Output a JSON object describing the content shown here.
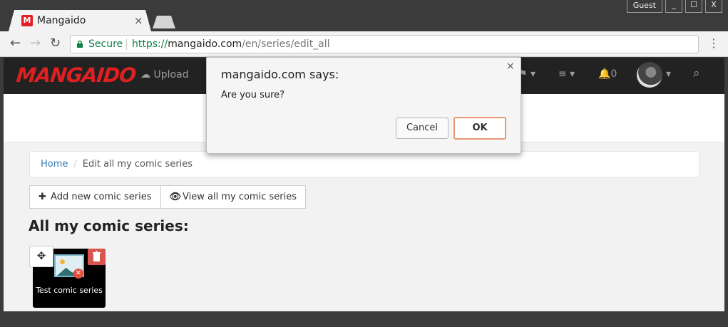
{
  "browser": {
    "tab_title": "Mangaido",
    "tab_favicon": "M",
    "tab_close": "×",
    "guest_label": "Guest",
    "win_minimize": "_",
    "win_maximize": "☐",
    "win_close": "X",
    "secure_label": "Secure",
    "url_scheme": "https://",
    "url_host": "mangaido.com",
    "url_path": "/en/series/edit_all",
    "back_icon": "←",
    "forward_icon": "→",
    "reload_icon": "↻",
    "menu_icon": "⋮"
  },
  "site": {
    "logo": "MANGAIDO",
    "upload_label": "Upload",
    "flag_label": "⚑ ▾",
    "list_label": "≡ ▾",
    "notifications_count": "0",
    "search_icon": "⌕",
    "avatar_caret": "▾"
  },
  "breadcrumb": {
    "home": "Home",
    "separator": "/",
    "current": "Edit all my comic series"
  },
  "actions": {
    "add_new": "Add new comic series",
    "view_all": "View all my comic series"
  },
  "section_title": "All my comic series:",
  "series": [
    {
      "title": "Test comic series"
    }
  ],
  "dialog": {
    "title": "mangaido.com says:",
    "message": "Are you sure?",
    "cancel_label": "Cancel",
    "ok_label": "OK",
    "close_label": "×"
  },
  "colors": {
    "brand": "#e02020",
    "navbar": "#222222",
    "link": "#337ab7",
    "secure": "#0b8043",
    "danger": "#d9534f"
  }
}
